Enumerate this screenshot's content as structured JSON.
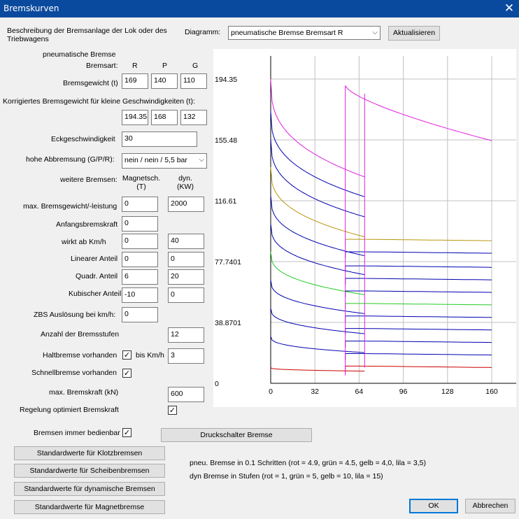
{
  "window": {
    "title": "Bremskurven",
    "close_glyph": "✕"
  },
  "description_label": "Beschreibung der Bremsanlage der Lok oder des Triebwagens",
  "diagram": {
    "label": "Diagramm:",
    "selected": "pneumatische Bremse Bremsart R",
    "refresh_label": "Aktualisieren"
  },
  "pneumatic": {
    "heading": "pneumatische Bremse",
    "bremsart_label": "Bremsart:",
    "col_r": "R",
    "col_p": "P",
    "col_g": "G",
    "weight_label": "Bremsgewicht (t)",
    "weight": {
      "r": "169",
      "p": "140",
      "g": "110"
    },
    "corr_label": "Korrigiertes Bremsgewicht für kleine Geschwindigkeiten (t):",
    "corr": {
      "r": "194.35",
      "p": "168",
      "g": "132"
    },
    "eck_label": "Eckgeschwindigkeit",
    "eck_value": "30",
    "hohe_label": "hohe Abbremsung (G/P/R):",
    "hohe_value": "nein / nein / 5,5 bar"
  },
  "further": {
    "label": "weitere Bremsen:",
    "col_t": "Magnetsch. (T)",
    "col_kw": "dyn. (KW)",
    "rows": [
      {
        "label": "max. Bremsgewicht/-leistung",
        "t": "0",
        "kw": "2000"
      },
      {
        "label": "Anfangsbremskraft",
        "t": "0"
      },
      {
        "label": "wirkt ab Km/h",
        "t": "0",
        "kw": "40"
      },
      {
        "label": "Linearer Anteil",
        "t": "0",
        "kw": "0"
      },
      {
        "label": "Quadr. Anteil",
        "t": "6",
        "kw": "20"
      },
      {
        "label": "Kubischer Anteil",
        "t": "-10",
        "kw": "0"
      },
      {
        "label": "ZBS Auslösung bei km/h:",
        "t": "0"
      }
    ],
    "stufen_label": "Anzahl der Bremsstufen",
    "stufen_value": "12",
    "halt_label": "Haltbremse vorhanden",
    "halt_checked": "✓",
    "halt_bis_label": "bis Km/h",
    "halt_bis_value": "3",
    "schnell_label": "Schnellbremse vorhanden",
    "schnell_checked": "✓",
    "maxkraft_label": "max. Bremskraft (kN)",
    "maxkraft_value": "600",
    "regelung_label": "Regelung optimiert Bremskraft",
    "regelung_checked": "✓",
    "immer_label": "Bremsen immer bedienbar",
    "immer_checked": "✓"
  },
  "buttons": {
    "druck": "Druckschalter Bremse",
    "klotz": "Standardwerte für Klotzbremsen",
    "scheiben": "Standardwerte für Scheibenbremsen",
    "dynamisch": "Standardwerte für dynamische Bremsen",
    "magnet": "Standardwerte für Magnetbremse",
    "ok": "OK",
    "cancel": "Abbrechen"
  },
  "legend": {
    "pneu": "pneu. Bremse in 0.1 Schritten  (rot = 4.9,  grün = 4.5, gelb = 4,0, lila = 3,5)",
    "dyn": "dyn Bremse in Stufen  (rot = 1, grün = 5, gelb = 10, lila = 15)"
  },
  "colors": {
    "red": "#cc0000",
    "green": "#22cc22",
    "yellow": "#b8960c",
    "purple": "#e020e0",
    "blue": "#0000b0",
    "grid": "#c0c0c0"
  },
  "chart_data": {
    "type": "line",
    "xlabel": "",
    "ylabel": "",
    "xlim": [
      0,
      160
    ],
    "ylim": [
      0,
      194.35
    ],
    "x_ticks": [
      "0",
      "32",
      "64",
      "96",
      "128",
      "160"
    ],
    "x_tick_values": [
      0,
      32,
      64,
      96,
      128,
      160
    ],
    "y_ticks": [
      "0",
      "38.8701",
      "77.7401",
      "116.61",
      "155.48",
      "194.35"
    ],
    "y_tick_values": [
      0,
      38.8701,
      77.7401,
      116.61,
      155.48,
      194.35
    ],
    "pneumatic_series": [
      {
        "color": "red",
        "v0": 10,
        "v160": 7
      },
      {
        "color": "blue",
        "v0": 30,
        "v160": 16
      },
      {
        "color": "blue",
        "v0": 48,
        "v160": 26
      },
      {
        "color": "blue",
        "v0": 66,
        "v160": 37
      },
      {
        "color": "green",
        "v0": 84,
        "v160": 47
      },
      {
        "color": "blue",
        "v0": 102,
        "v160": 58
      },
      {
        "color": "blue",
        "v0": 120,
        "v160": 68
      },
      {
        "color": "yellow",
        "v0": 138,
        "v160": 78
      },
      {
        "color": "blue",
        "v0": 156,
        "v160": 89
      },
      {
        "color": "blue",
        "v0": 174,
        "v160": 100
      },
      {
        "color": "purple",
        "v0": 194.35,
        "v160": 110
      }
    ],
    "dynamic_series": [
      {
        "color": "red",
        "x_start": 54,
        "y": 11
      },
      {
        "color": "blue",
        "x_start": 54,
        "y": 19
      },
      {
        "color": "blue",
        "x_start": 54,
        "y": 27
      },
      {
        "color": "blue",
        "x_start": 54,
        "y": 35
      },
      {
        "color": "blue",
        "x_start": 54,
        "y": 43
      },
      {
        "color": "green",
        "x_start": 54,
        "y": 51
      },
      {
        "color": "blue",
        "x_start": 54,
        "y": 59
      },
      {
        "color": "blue",
        "x_start": 54,
        "y": 67
      },
      {
        "color": "blue",
        "x_start": 54,
        "y": 75
      },
      {
        "color": "blue",
        "x_start": 54,
        "y": 84
      },
      {
        "color": "yellow",
        "x_start": 54,
        "y": 92
      },
      {
        "color": "purple",
        "x_start": 54,
        "y": 190
      }
    ]
  }
}
